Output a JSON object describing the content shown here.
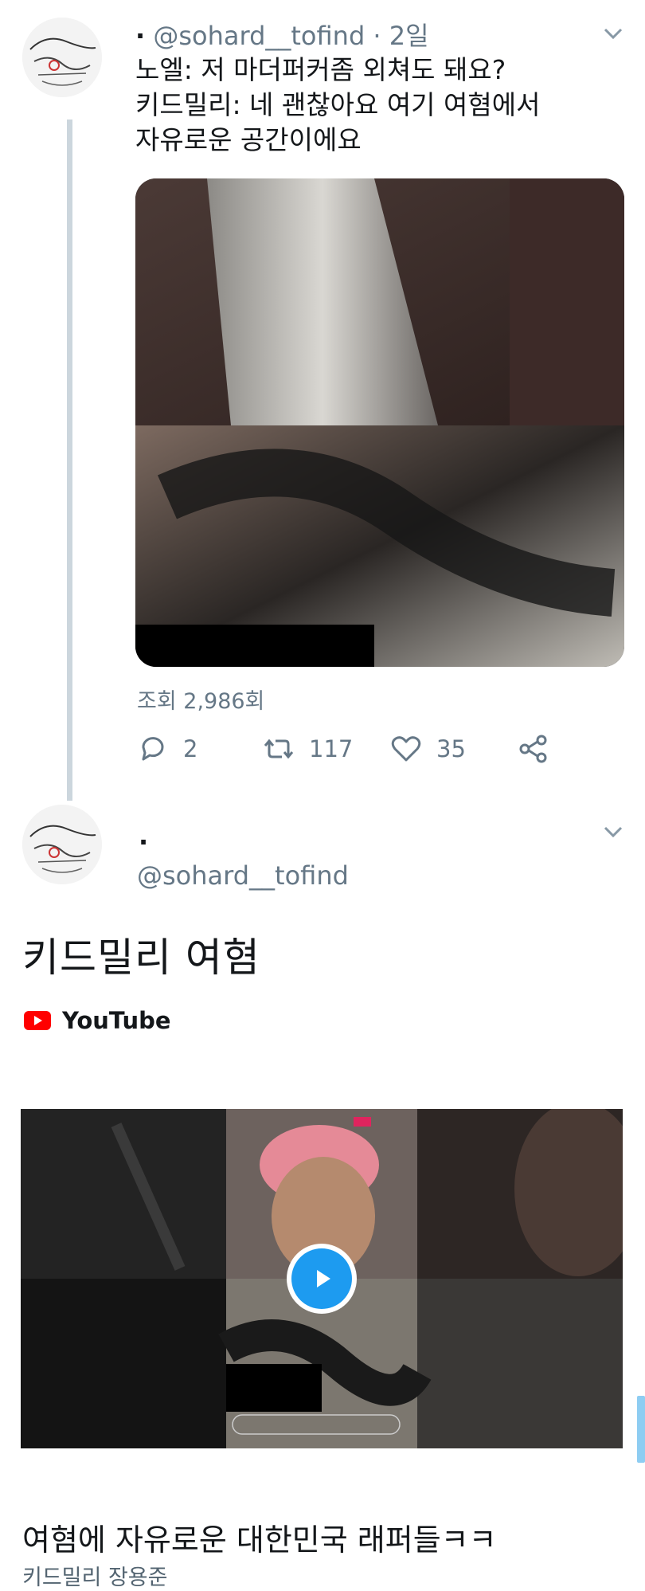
{
  "tweet1": {
    "handle": "@sohard__tofind",
    "separator": "·",
    "time": "2일",
    "lines": [
      "노엘: 저 마더퍼커좀 외쳐도 돼요?",
      "키드밀리: 네 괜찮아요 여기 여혐에서",
      "자유로운 공간이에요"
    ],
    "views": "조회 2,986회",
    "actions": {
      "replies": "2",
      "retweets": "117",
      "likes": "35"
    }
  },
  "tweet2": {
    "display_name": ".",
    "handle": "@sohard__tofind",
    "title": "키드밀리 여혐",
    "source": "YouTube"
  },
  "bottom": {
    "title": "여혐에 자유로운 대한민국 래퍼들ㅋㅋ",
    "subtitle": "키드밀리 장용준"
  },
  "colors": {
    "accent": "#1d9bf0",
    "muted": "#657786",
    "youtube": "#ff0000"
  }
}
